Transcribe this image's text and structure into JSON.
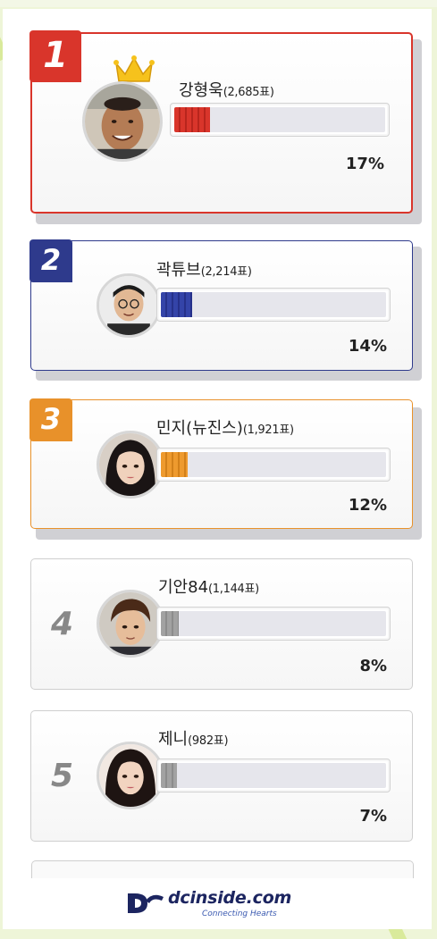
{
  "ranking": [
    {
      "rank": "1",
      "name": "강형욱",
      "votes": "(2,685표)",
      "percent": "17%",
      "fill_fraction": 0.17,
      "theme": "#d9352b",
      "avatar": "avatar-man-smiling",
      "crown": true
    },
    {
      "rank": "2",
      "name": "곽튜브",
      "votes": "(2,214표)",
      "percent": "14%",
      "fill_fraction": 0.14,
      "theme": "#2e3a8c",
      "avatar": "avatar-man-glasses",
      "crown": false
    },
    {
      "rank": "3",
      "name": "민지(뉴진스)",
      "votes": "(1,921표)",
      "percent": "12%",
      "fill_fraction": 0.12,
      "theme": "#e8912a",
      "avatar": "avatar-woman-dark-hair",
      "crown": false
    },
    {
      "rank": "4",
      "name": "기안84",
      "votes": "(1,144표)",
      "percent": "8%",
      "fill_fraction": 0.08,
      "theme": "#9a9a9a",
      "avatar": "avatar-man-brown-hair",
      "crown": false
    },
    {
      "rank": "5",
      "name": "제니",
      "votes": "(982표)",
      "percent": "7%",
      "fill_fraction": 0.07,
      "theme": "#9a9a9a",
      "avatar": "avatar-woman-long-hair",
      "crown": false
    }
  ],
  "footer": {
    "logo_text": "dcinside.com",
    "tagline": "Connecting Hearts"
  }
}
